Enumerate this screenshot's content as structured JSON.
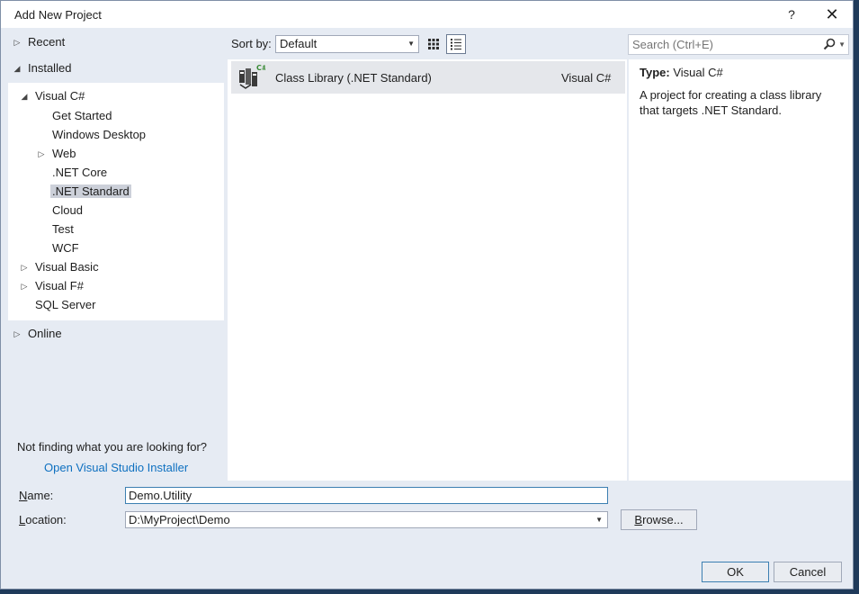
{
  "window": {
    "title": "Add New Project",
    "help_glyph": "?",
    "close_glyph": "✕"
  },
  "tree": {
    "recent": "Recent",
    "installed": "Installed",
    "visual_csharp": "Visual C#",
    "csharp_children": [
      "Get Started",
      "Windows Desktop",
      "Web",
      ".NET Core",
      ".NET Standard",
      "Cloud",
      "Test",
      "WCF"
    ],
    "selected": ".NET Standard",
    "visual_basic": "Visual Basic",
    "visual_fsharp": "Visual F#",
    "sql_server": "SQL Server",
    "online": "Online"
  },
  "help": {
    "not_finding": "Not finding what you are looking for?",
    "installer_link": "Open Visual Studio Installer"
  },
  "toolbar": {
    "sort_label": "Sort by:",
    "sort_value": "Default",
    "search_placeholder": "Search (Ctrl+E)"
  },
  "templates": [
    {
      "name": "Class Library (.NET Standard)",
      "language": "Visual C#",
      "icon": "class-library-csharp-icon"
    }
  ],
  "details": {
    "type_label": "Type:",
    "type_value": "Visual C#",
    "description": "A project for creating a class library that targets .NET Standard."
  },
  "form": {
    "name_label_underlined": "N",
    "name_label_rest": "ame:",
    "name_value": "Demo.Utility",
    "location_label_underlined": "L",
    "location_label_rest": "ocation:",
    "location_value": "D:\\MyProject\\Demo",
    "browse_underlined": "B",
    "browse_rest": "rowse..."
  },
  "buttons": {
    "ok": "OK",
    "cancel": "Cancel"
  },
  "colors": {
    "accent_link": "#0e70c0",
    "selection": "#ccd0d9",
    "chrome": "#e6ebf3"
  }
}
